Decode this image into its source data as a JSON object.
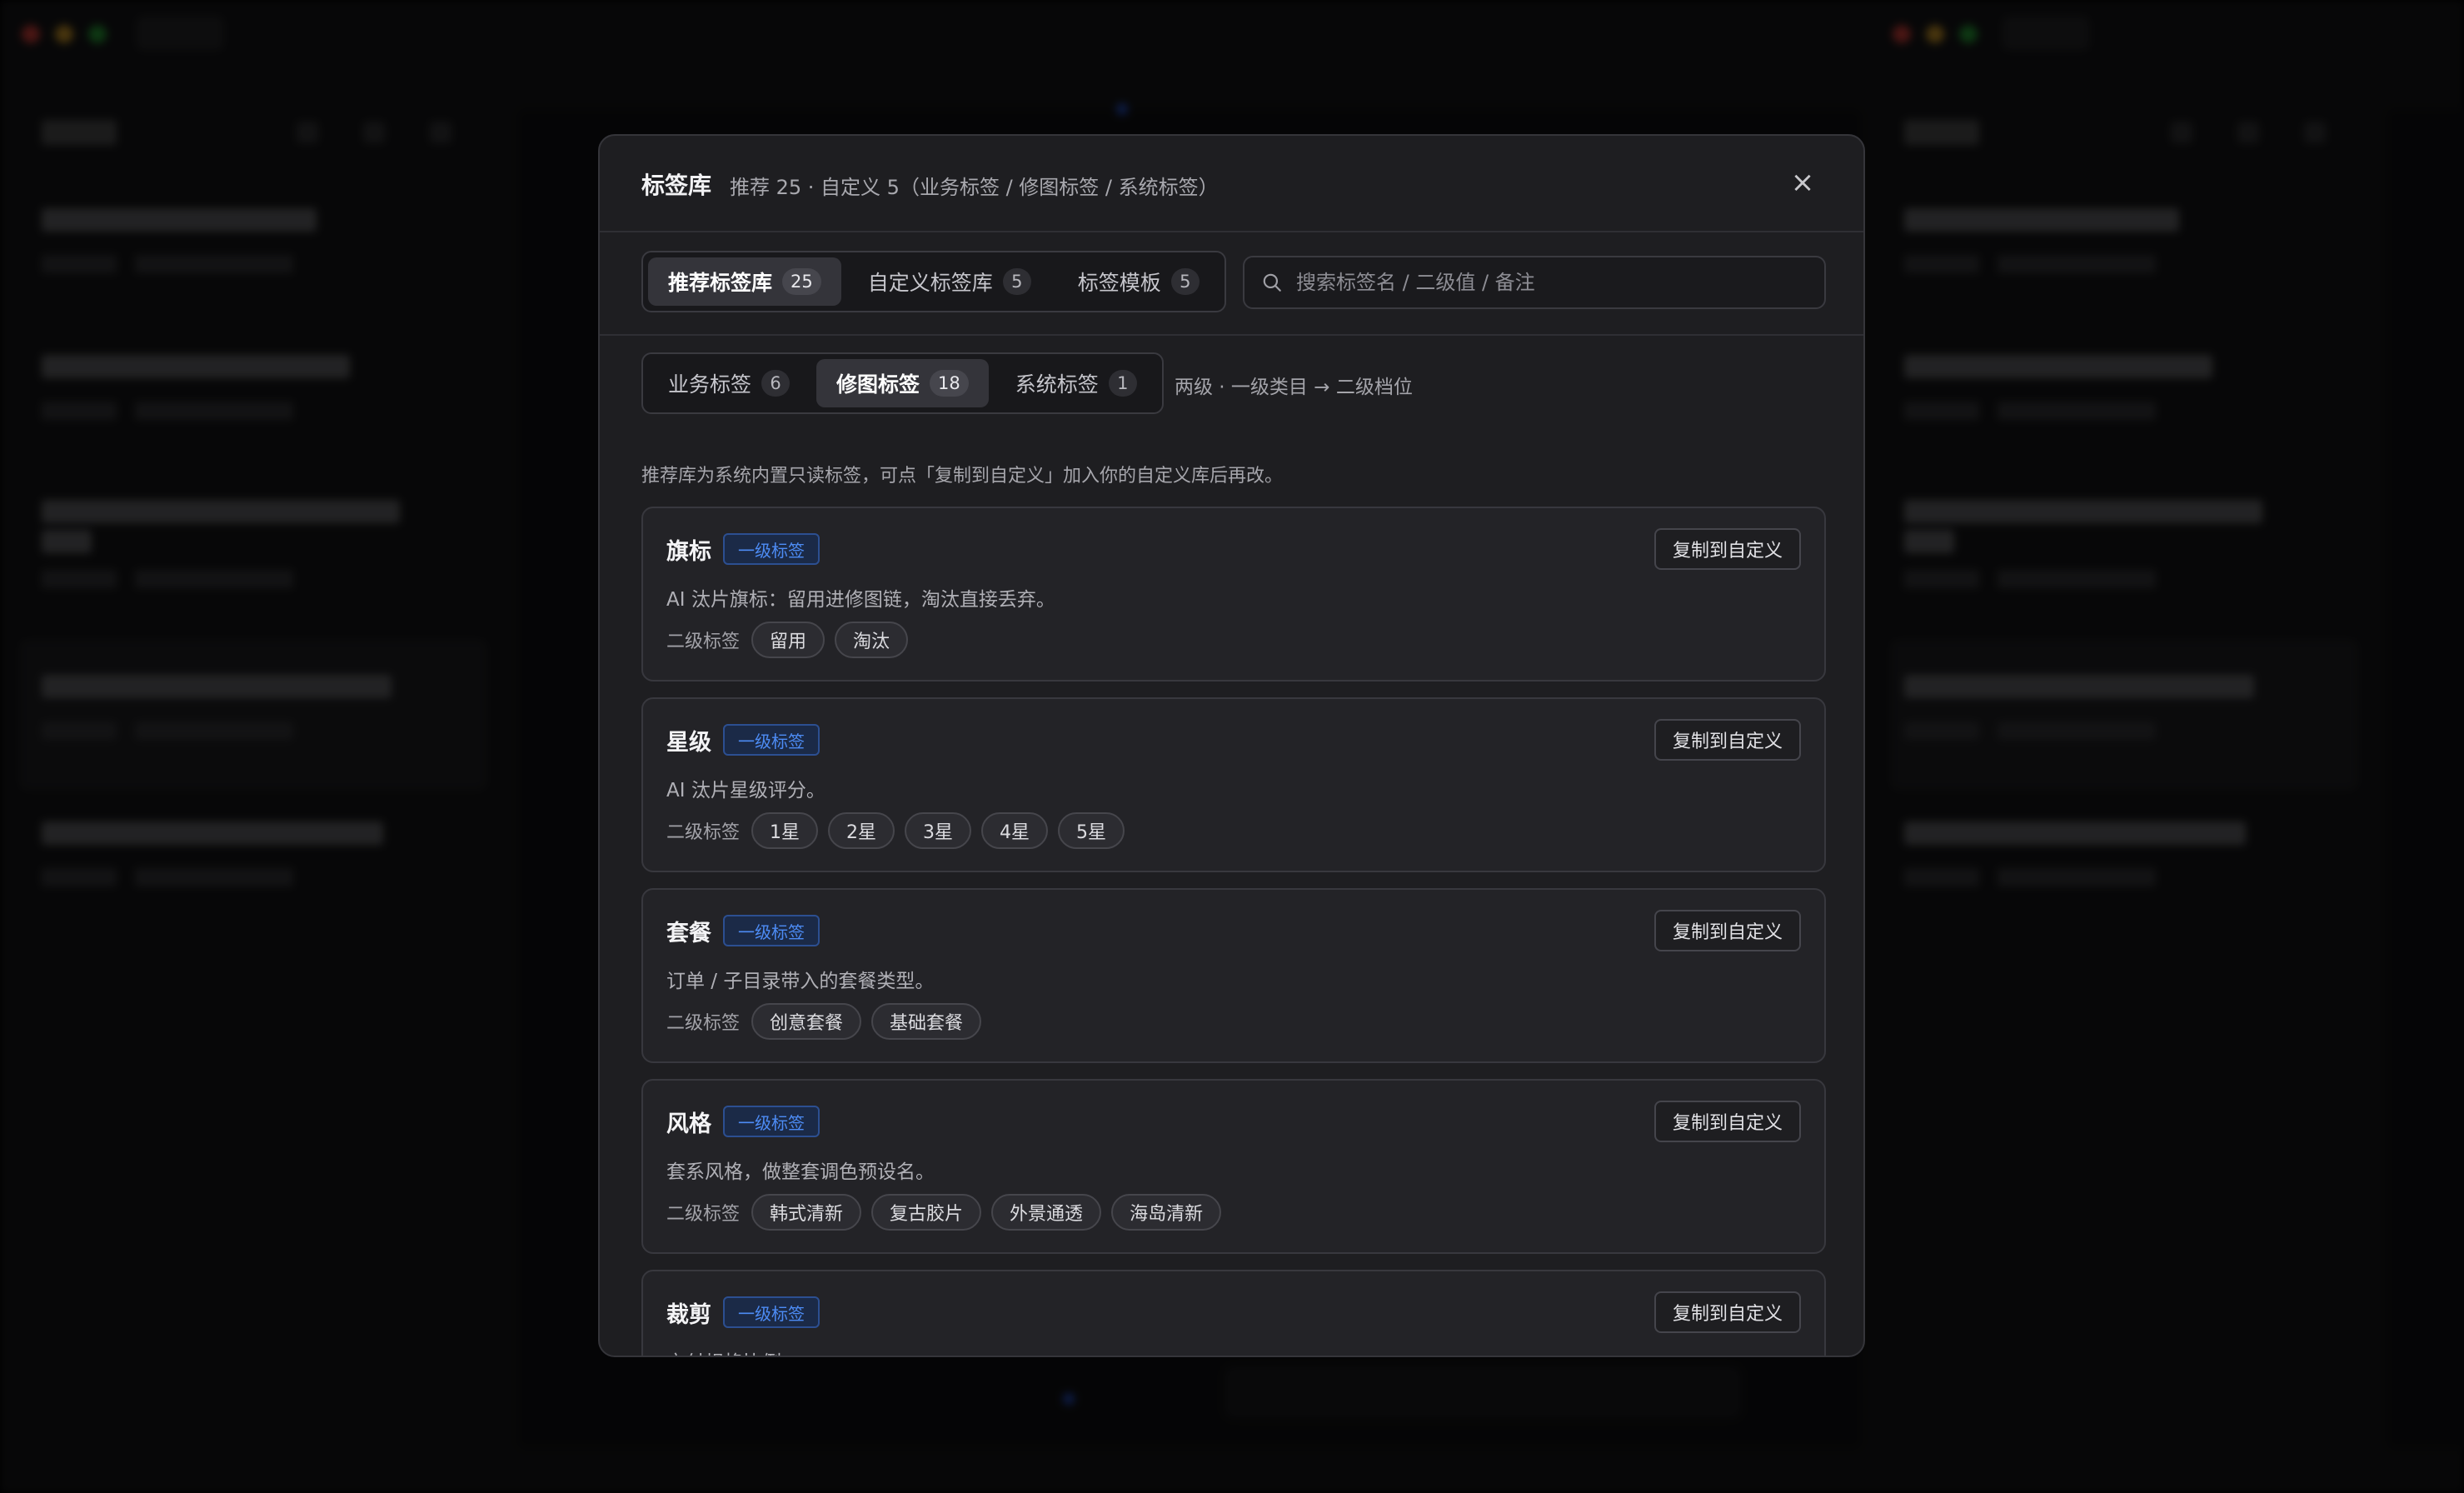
{
  "modal": {
    "title": "标签库",
    "subtitle": "推荐 25 · 自定义 5（业务标签 / 修图标签 / 系统标签）",
    "close_glyph": "×",
    "library_tabs": [
      {
        "label": "推荐标签库",
        "count": "25",
        "active": true
      },
      {
        "label": "自定义标签库",
        "count": "5",
        "active": false
      },
      {
        "label": "标签模板",
        "count": "5",
        "active": false
      }
    ],
    "search": {
      "placeholder": "搜索标签名 / 二级值 / 备注",
      "value": ""
    },
    "category_tabs": [
      {
        "label": "业务标签",
        "count": "6",
        "active": false
      },
      {
        "label": "修图标签",
        "count": "18",
        "active": true
      },
      {
        "label": "系统标签",
        "count": "1",
        "active": false
      }
    ],
    "structure_hint": "两级 · 一级类目 → 二级档位",
    "info": "推荐库为系统内置只读标签，可点「复制到自定义」加入你的自定义库后再改。",
    "sub_label": "二级标签",
    "level_badge": "一级标签",
    "copy_label": "复制到自定义",
    "tags": [
      {
        "name": "旗标",
        "desc": "AI 汰片旗标：留用进修图链，淘汰直接丢弃。",
        "values": [
          "留用",
          "淘汰"
        ]
      },
      {
        "name": "星级",
        "desc": "AI 汰片星级评分。",
        "values": [
          "1星",
          "2星",
          "3星",
          "4星",
          "5星"
        ]
      },
      {
        "name": "套餐",
        "desc": "订单 / 子目录带入的套餐类型。",
        "values": [
          "创意套餐",
          "基础套餐"
        ]
      },
      {
        "name": "风格",
        "desc": "套系风格，做整套调色预设名。",
        "values": [
          "韩式清新",
          "复古胶片",
          "外景通透",
          "海岛清新"
        ]
      },
      {
        "name": "裁剪",
        "desc": "交付规格比例。",
        "values": []
      }
    ]
  },
  "colors": {
    "accent": "#4d8cf5",
    "modal_bg": "#1e1e21",
    "page_bg": "#000000"
  }
}
